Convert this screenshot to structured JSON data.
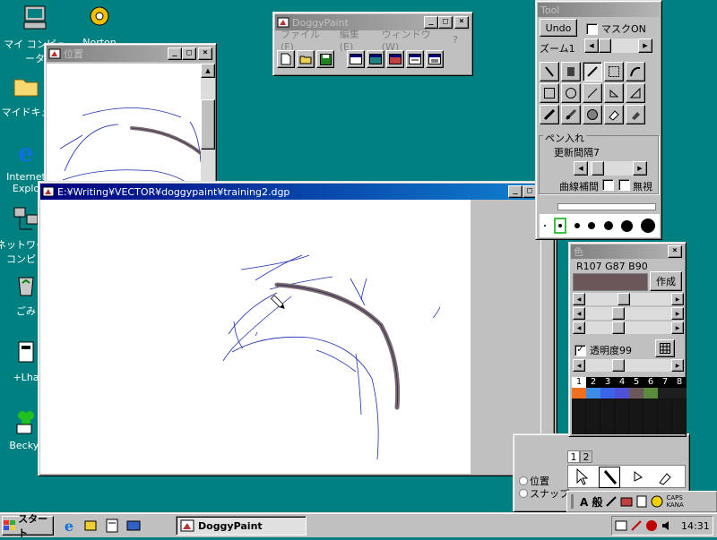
{
  "desktop": {
    "icons": [
      {
        "label": "マイ コンピュータ",
        "icon": "my-computer-icon"
      },
      {
        "label": "Norton",
        "icon": "norton-icon"
      },
      {
        "label": "マイドキュ",
        "icon": "my-documents-icon"
      },
      {
        "label": "Internet Explo",
        "icon": "internet-explorer-icon"
      },
      {
        "label": "ネットワーク コンピュ",
        "icon": "network-icon"
      },
      {
        "label": "ごみ",
        "icon": "recycle-bin-icon"
      },
      {
        "label": "+Lha",
        "icon": "lha-icon"
      },
      {
        "label": "Becky!",
        "icon": "becky-icon"
      }
    ]
  },
  "doggypaint": {
    "title": "DoggyPaint",
    "menu": [
      "ファイル(F)",
      "編集(E)",
      "ウィンドウ(W)",
      "?"
    ],
    "toolbar_icons": [
      "new-icon",
      "open-icon",
      "save-icon",
      "window1-icon",
      "window2-icon",
      "window3-icon",
      "window4-icon",
      "window5-icon"
    ]
  },
  "position_window": {
    "title": "位置"
  },
  "document_window": {
    "title": "E:¥Writing¥VECTOR¥doggypaint¥training2.dgp"
  },
  "tool_palette": {
    "title": "Tool",
    "undo_label": "Undo",
    "mask_label": "マスクON",
    "zoom_label": "ズーム1",
    "pen_section_title": "ペン入れ",
    "update_interval_label": "更新間隔7",
    "curve_label": "曲線補間",
    "disable_label": "無視"
  },
  "color_window": {
    "title": "色",
    "rgb_text": "R107 G87 B90",
    "create_label": "作成",
    "opacity_label": "透明度99",
    "current_color": "#6b575a",
    "palette_numbers": [
      "1",
      "2",
      "3",
      "4",
      "5",
      "6",
      "7",
      "8"
    ],
    "palette_colors": [
      "#f07020",
      "#3c8ce8",
      "#3c64e8",
      "#5050d8",
      "#6b575a",
      "#5a8a3c",
      "#141414",
      "#141414"
    ]
  },
  "layer_window": {
    "tabs": [
      "1",
      "2"
    ],
    "position_label": "位置",
    "snap_label": "スナップ"
  },
  "taskbar": {
    "start_label": "スタート",
    "task_label": "DoggyPaint",
    "clock": "14:31",
    "ime_text": "A 般",
    "caps_label": "CAPS",
    "kana_label": "KANA"
  }
}
